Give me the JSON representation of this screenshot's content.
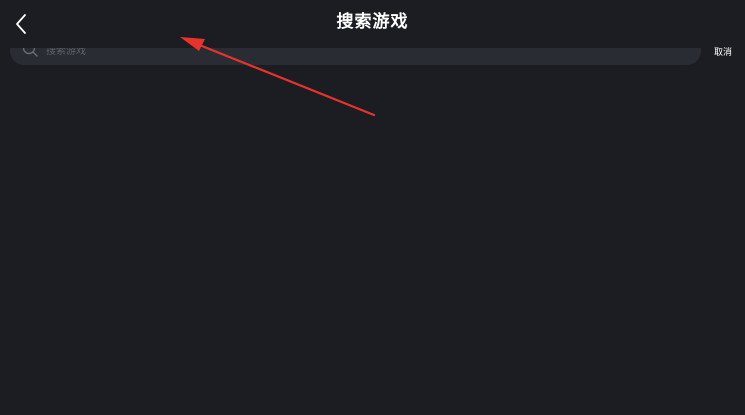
{
  "header": {
    "title": "搜索游戏",
    "back_icon": "chevron-left-icon"
  },
  "search": {
    "placeholder": "搜索游戏",
    "value": "",
    "icon": "search-icon",
    "cancel_label": "取消"
  },
  "colors": {
    "background": "#1c1d22",
    "search_bg": "#2a2c33",
    "text": "#ffffff",
    "placeholder": "#5f6168",
    "annotation": "#e8322c"
  },
  "annotation": {
    "type": "arrow",
    "points_to": "back-button"
  }
}
